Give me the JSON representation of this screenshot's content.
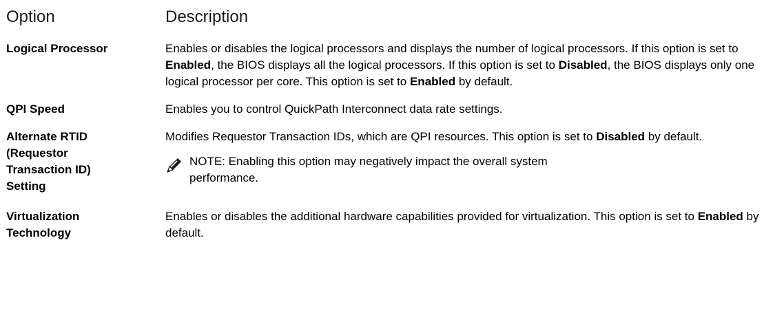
{
  "header": {
    "option_label": "Option",
    "description_label": "Description"
  },
  "rows": [
    {
      "option": "Logical Processor",
      "description": [
        {
          "t": "Enables or disables the logical processors and displays the number of logical processors. If this option is set to "
        },
        {
          "b": "Enabled"
        },
        {
          "t": ", the BIOS displays all the logical processors. If this option is set to "
        },
        {
          "b": "Disabled"
        },
        {
          "t": ", the BIOS displays only one logical processor per core. This option is set to "
        },
        {
          "b": "Enabled"
        },
        {
          "t": " by default."
        }
      ]
    },
    {
      "option": "QPI Speed",
      "description": [
        {
          "t": "Enables you to control QuickPath Interconnect data rate settings."
        }
      ]
    },
    {
      "option": "Alternate RTID\n(Requestor\nTransaction ID)\nSetting",
      "description": [
        {
          "t": "Modifies Requestor Transaction IDs, which are QPI resources. This option is set to "
        },
        {
          "b": "Disabled"
        },
        {
          "t": " by default."
        }
      ],
      "note": {
        "icon": "note-pencil-icon",
        "label": "NOTE:",
        "text": " Enabling this option may negatively impact the overall system performance."
      }
    },
    {
      "option": "Virtualization\nTechnology",
      "description": [
        {
          "t": "Enables or disables the additional hardware capabilities provided for virtualization. This option is set to "
        },
        {
          "b": "Enabled"
        },
        {
          "t": " by default."
        }
      ]
    }
  ]
}
